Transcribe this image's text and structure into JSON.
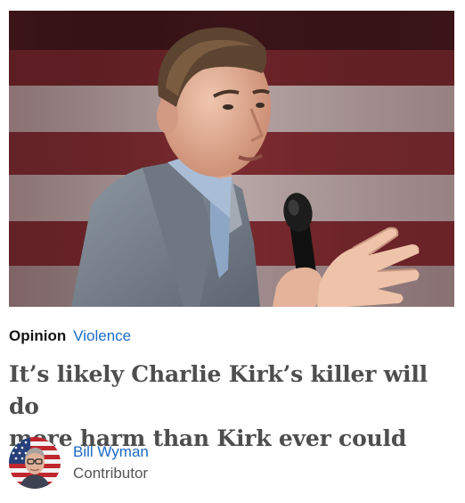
{
  "article": {
    "hero_image": {
      "icon": "speaker-photo",
      "description_colors": {
        "background_red": "#7a2a2e",
        "background_light": "#b9a8a8",
        "jacket": "#7d8794",
        "shirt": "#9fb4cf",
        "skin": "#e8b9a2",
        "hair": "#5a4330"
      }
    },
    "kicker": {
      "section": "Opinion",
      "topic": "Violence"
    },
    "headline": {
      "line1": "It’s likely Charlie Kirk’s killer will do",
      "line2": "more harm than Kirk ever could"
    },
    "byline": {
      "avatar_icon": "author-avatar-flag",
      "name": "Bill Wyman",
      "role": "Contributor"
    }
  },
  "colors": {
    "link": "#1a6ac6",
    "headline": "#4e4e4e",
    "text": "#121212",
    "muted": "#555555"
  }
}
